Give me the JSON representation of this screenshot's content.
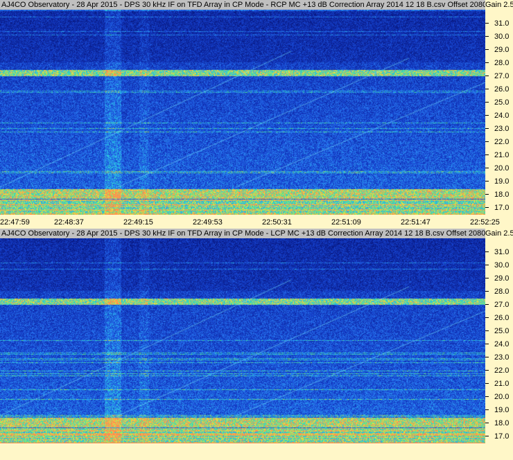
{
  "panels": [
    {
      "title": "AJ4CO Observatory - 28 Apr 2015 - DPS 30 kHz IF on TFD Array in CP Mode - RCP  MC +13 dB  Correction Array 2014 12 18 B.csv  Offset 2080",
      "gain": "Gain 2.5",
      "polarization": "RCP"
    },
    {
      "title": "AJ4CO Observatory - 28 Apr 2015 - DPS 30 kHz IF on TFD Array in CP Mode - LCP  MC +13 dB  Correction Array 2014 12 18 B.csv  Offset 2080",
      "gain": "Gain 2.5",
      "polarization": "LCP"
    }
  ],
  "frequency_axis": {
    "ticks": [
      "31.0",
      "30.0",
      "29.0",
      "28.0",
      "27.0",
      "26.0",
      "25.0",
      "24.0",
      "23.0",
      "22.0",
      "21.0",
      "20.0",
      "19.0",
      "18.0",
      "17.0"
    ],
    "range_mhz": [
      16.4,
      32.0
    ]
  },
  "time_axis": {
    "ticks": [
      "22:47:59",
      "22:48:37",
      "22:49:15",
      "22:49:53",
      "22:50:31",
      "22:51:09",
      "22:51:47",
      "22:52:25"
    ]
  },
  "colors": {
    "background": "#fff7c8",
    "title_bar": "#c0c0c0",
    "spectrogram_low": "#0a1a8a",
    "spectrogram_mid": "#2d6fe0",
    "spectrogram_high": "#ffe24a"
  }
}
